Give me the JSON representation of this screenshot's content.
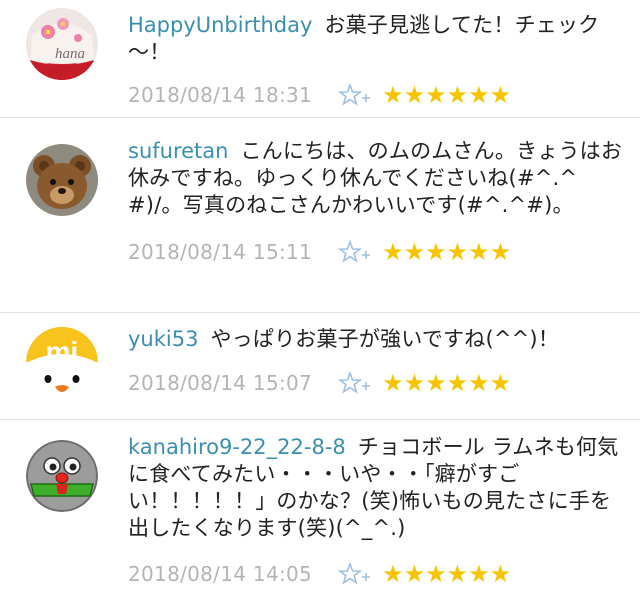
{
  "comments": [
    {
      "username": "HappyUnbirthday",
      "avatar_icon": "cupcake-hana-icon",
      "avatar_text": "hana",
      "text": "お菓子見逃してた！チェック～！",
      "timestamp": "2018/08/14 18:31",
      "add_star_icon": "add-star-icon",
      "stars": "★★★★★★"
    },
    {
      "username": "sufuretan",
      "avatar_icon": "teddy-bear-icon",
      "text": "こんにちは、のムのムさん。きょうはお休みですね。ゆっくり休んでくださいね(#^.^#)/。写真のねこさんかわいいです(#^.^#)。",
      "timestamp": "2018/08/14 15:11",
      "add_star_icon": "add-star-icon",
      "stars": "★★★★★★"
    },
    {
      "username": "yuki53",
      "avatar_icon": "mi-chick-icon",
      "avatar_text": "mi",
      "text": "やっぱりお菓子が強いですね(^^)！",
      "timestamp": "2018/08/14 15:07",
      "add_star_icon": "add-star-icon",
      "stars": "★★★★★★"
    },
    {
      "username": "kanahiro9-22_22-8-8",
      "avatar_icon": "robot-face-icon",
      "text": "チョコボール ラムネも何気に食べてみたい・・・いや・・「癖がすごい！！！！！」のかな？(笑)怖いもの見たさに手を出したくなります(笑)(^_^.)",
      "timestamp": "2018/08/14 14:05",
      "add_star_icon": "add-star-icon",
      "stars": "★★★★★★"
    }
  ],
  "colors": {
    "username": "#3a8fb0",
    "text": "#222222",
    "timestamp": "#b4b4b4",
    "star": "#f6c400",
    "add_star": "#9cc0e3",
    "divider": "#e2e2e2"
  }
}
